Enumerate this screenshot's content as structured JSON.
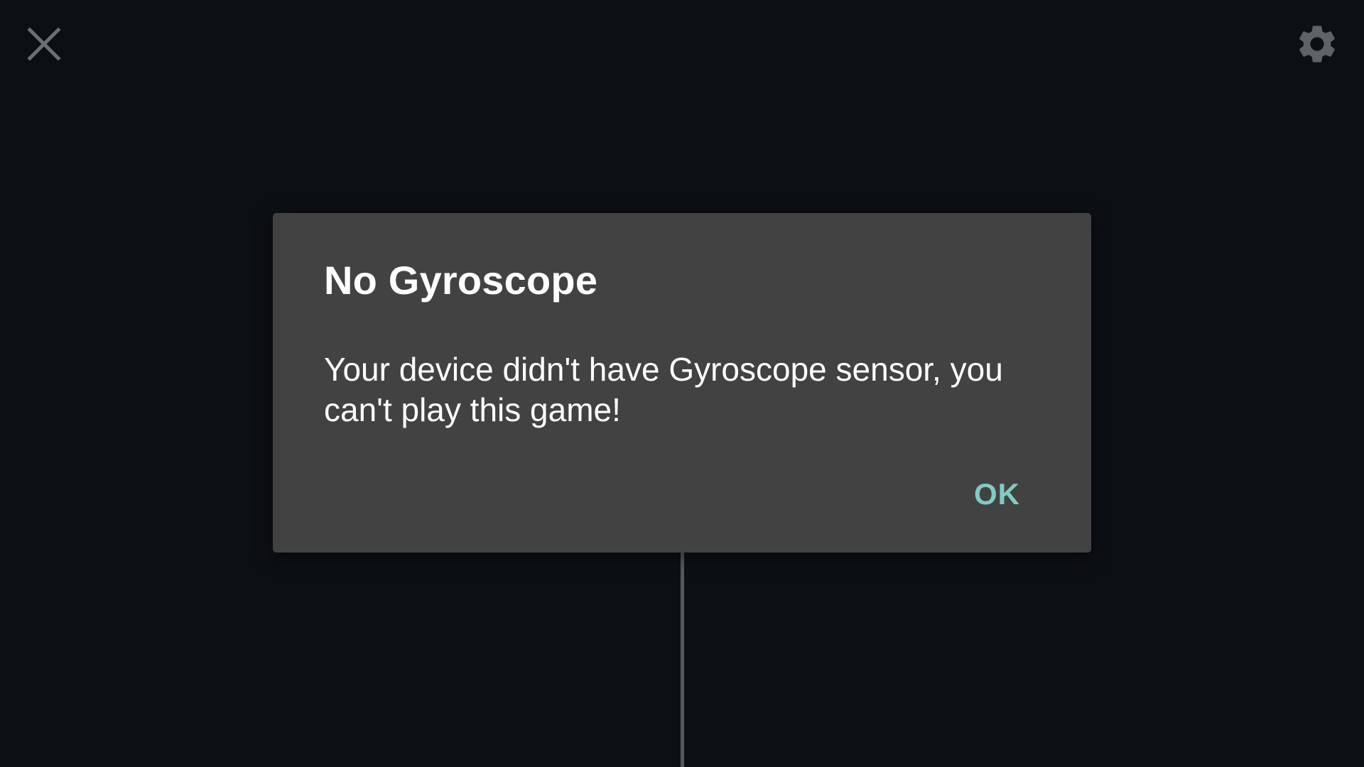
{
  "toolbar": {
    "close_icon": "close-icon",
    "settings_icon": "gear-icon"
  },
  "dialog": {
    "title": "No Gyroscope",
    "message": "Your device didn't have Gyroscope sensor, you can't play this game!",
    "ok_label": "OK"
  },
  "colors": {
    "background": "#0c0f14",
    "dialog_background": "#424242",
    "accent": "#80cbc4",
    "icon": "#5f6368"
  }
}
